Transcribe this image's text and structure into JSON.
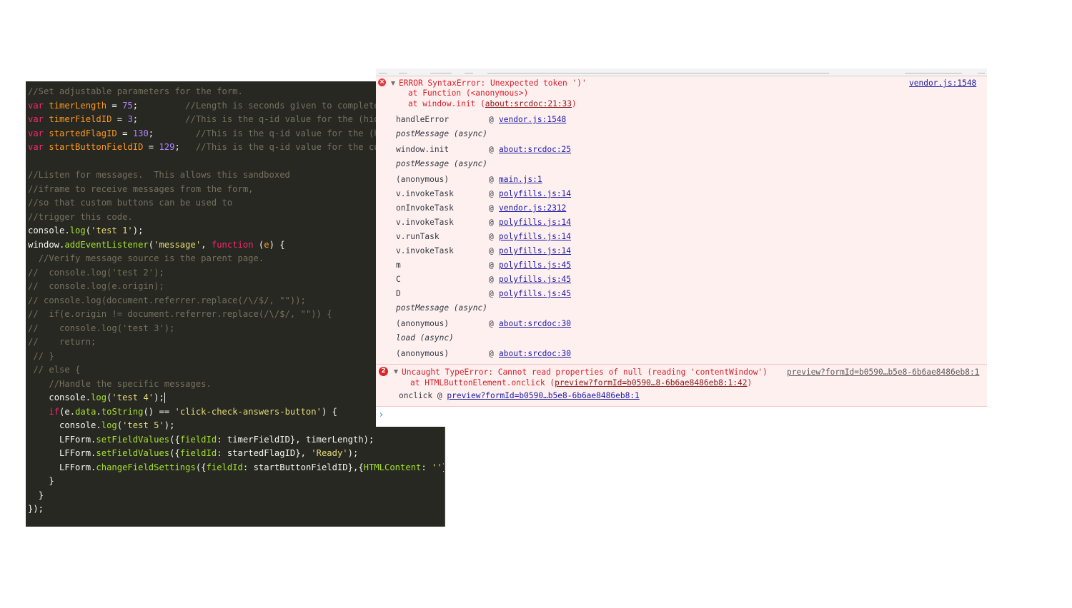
{
  "editor": {
    "lines": [
      {
        "indent": "",
        "tokens": [
          {
            "t": "//Set adjustable parameters for the form.",
            "c": "comment"
          }
        ]
      },
      {
        "indent": "",
        "tokens": [
          {
            "t": "var ",
            "c": "kw"
          },
          {
            "t": "timerLength",
            "c": "var"
          },
          {
            "t": " = ",
            "c": "plain"
          },
          {
            "t": "75",
            "c": "num"
          },
          {
            "t": ";         ",
            "c": "plain"
          },
          {
            "t": "//Length is seconds given to complete",
            "c": "comment"
          }
        ]
      },
      {
        "indent": "",
        "tokens": [
          {
            "t": "var ",
            "c": "kw"
          },
          {
            "t": "timerFieldID",
            "c": "var"
          },
          {
            "t": " = ",
            "c": "plain"
          },
          {
            "t": "3",
            "c": "num"
          },
          {
            "t": ";         ",
            "c": "plain"
          },
          {
            "t": "//This is the q-id value for the (hidd",
            "c": "comment"
          }
        ]
      },
      {
        "indent": "",
        "tokens": [
          {
            "t": "var ",
            "c": "kw"
          },
          {
            "t": "startedFlagID",
            "c": "var"
          },
          {
            "t": " = ",
            "c": "plain"
          },
          {
            "t": "130",
            "c": "num"
          },
          {
            "t": ";        ",
            "c": "plain"
          },
          {
            "t": "//This is the q-id value for the (hi",
            "c": "comment"
          }
        ]
      },
      {
        "indent": "",
        "tokens": [
          {
            "t": "var ",
            "c": "kw"
          },
          {
            "t": "startButtonFieldID",
            "c": "var"
          },
          {
            "t": " = ",
            "c": "plain"
          },
          {
            "t": "129",
            "c": "num"
          },
          {
            "t": ";   ",
            "c": "plain"
          },
          {
            "t": "//This is the q-id value for the cus",
            "c": "comment"
          }
        ]
      },
      {
        "indent": "",
        "tokens": []
      },
      {
        "indent": "",
        "tokens": [
          {
            "t": "//Listen for messages.  This allows this sandboxed",
            "c": "comment"
          }
        ]
      },
      {
        "indent": "",
        "tokens": [
          {
            "t": "//iframe to receive messages from the form,",
            "c": "comment"
          }
        ]
      },
      {
        "indent": "",
        "tokens": [
          {
            "t": "//so that custom buttons can be used to",
            "c": "comment"
          }
        ]
      },
      {
        "indent": "",
        "tokens": [
          {
            "t": "//trigger this code.",
            "c": "comment"
          }
        ]
      },
      {
        "indent": "",
        "tokens": [
          {
            "t": "console.",
            "c": "plain"
          },
          {
            "t": "log",
            "c": "fn"
          },
          {
            "t": "(",
            "c": "plain"
          },
          {
            "t": "'test 1'",
            "c": "str"
          },
          {
            "t": ");",
            "c": "plain"
          }
        ]
      },
      {
        "indent": "",
        "tokens": [
          {
            "t": "window.",
            "c": "plain"
          },
          {
            "t": "addEventListener",
            "c": "fn"
          },
          {
            "t": "(",
            "c": "plain"
          },
          {
            "t": "'message'",
            "c": "str"
          },
          {
            "t": ", ",
            "c": "plain"
          },
          {
            "t": "function",
            "c": "kw"
          },
          {
            "t": " (",
            "c": "plain"
          },
          {
            "t": "e",
            "c": "var"
          },
          {
            "t": ") {",
            "c": "plain"
          }
        ]
      },
      {
        "indent": "  ",
        "tokens": [
          {
            "t": "//Verify message source is the parent page.",
            "c": "comment"
          }
        ]
      },
      {
        "indent": "",
        "tokens": [
          {
            "t": "//  console.log('test 2');",
            "c": "comment"
          }
        ]
      },
      {
        "indent": "",
        "tokens": [
          {
            "t": "//  console.log(e.origin);",
            "c": "comment"
          }
        ]
      },
      {
        "indent": "",
        "tokens": [
          {
            "t": "// console.log(document.referrer.replace(/\\/$/, \"\"));",
            "c": "comment"
          }
        ]
      },
      {
        "indent": "",
        "tokens": [
          {
            "t": "//  if(e.origin != document.referrer.replace(/\\/$/, \"\")) {",
            "c": "comment"
          }
        ]
      },
      {
        "indent": "",
        "tokens": [
          {
            "t": "//    console.log('test 3');",
            "c": "comment"
          }
        ]
      },
      {
        "indent": "",
        "tokens": [
          {
            "t": "//    return;",
            "c": "comment"
          }
        ]
      },
      {
        "indent": " ",
        "tokens": [
          {
            "t": "// }",
            "c": "comment"
          }
        ]
      },
      {
        "indent": " ",
        "tokens": [
          {
            "t": "// else {",
            "c": "comment"
          }
        ]
      },
      {
        "indent": "    ",
        "tokens": [
          {
            "t": "//Handle the specific messages.",
            "c": "comment"
          }
        ]
      },
      {
        "indent": "    ",
        "tokens": [
          {
            "t": "console.",
            "c": "plain"
          },
          {
            "t": "log",
            "c": "fn"
          },
          {
            "t": "(",
            "c": "plain"
          },
          {
            "t": "'test 4'",
            "c": "str"
          },
          {
            "t": ");",
            "c": "plain"
          }
        ],
        "caret": true
      },
      {
        "indent": "    ",
        "tokens": [
          {
            "t": "if",
            "c": "kw"
          },
          {
            "t": "(e.",
            "c": "plain"
          },
          {
            "t": "data",
            "c": "fn"
          },
          {
            "t": ".",
            "c": "plain"
          },
          {
            "t": "toString",
            "c": "fn"
          },
          {
            "t": "() == ",
            "c": "plain"
          },
          {
            "t": "'click-check-answers-button'",
            "c": "str"
          },
          {
            "t": ") {",
            "c": "plain"
          }
        ]
      },
      {
        "indent": "      ",
        "tokens": [
          {
            "t": "console.",
            "c": "plain"
          },
          {
            "t": "log",
            "c": "fn"
          },
          {
            "t": "(",
            "c": "plain"
          },
          {
            "t": "'test 5'",
            "c": "str"
          },
          {
            "t": ");",
            "c": "plain"
          }
        ]
      },
      {
        "indent": "      ",
        "tokens": [
          {
            "t": "LFForm.",
            "c": "plain"
          },
          {
            "t": "setFieldValues",
            "c": "fn"
          },
          {
            "t": "({",
            "c": "plain"
          },
          {
            "t": "fieldId",
            "c": "fn"
          },
          {
            "t": ": timerFieldID}, timerLength);",
            "c": "plain"
          }
        ]
      },
      {
        "indent": "      ",
        "tokens": [
          {
            "t": "LFForm.",
            "c": "plain"
          },
          {
            "t": "setFieldValues",
            "c": "fn"
          },
          {
            "t": "({",
            "c": "plain"
          },
          {
            "t": "fieldId",
            "c": "fn"
          },
          {
            "t": ": startedFlagID}, ",
            "c": "plain"
          },
          {
            "t": "'Ready'",
            "c": "str"
          },
          {
            "t": ");",
            "c": "plain"
          }
        ]
      },
      {
        "indent": "      ",
        "tokens": [
          {
            "t": "LFForm.",
            "c": "plain"
          },
          {
            "t": "changeFieldSettings",
            "c": "fn"
          },
          {
            "t": "({",
            "c": "plain"
          },
          {
            "t": "fieldId",
            "c": "fn"
          },
          {
            "t": ": startButtonFieldID},{",
            "c": "plain"
          },
          {
            "t": "HTMLContent",
            "c": "fn"
          },
          {
            "t": ": ",
            "c": "plain"
          },
          {
            "t": "''",
            "c": "str"
          },
          {
            "t": "});",
            "c": "plain"
          }
        ]
      },
      {
        "indent": "    ",
        "tokens": [
          {
            "t": "}",
            "c": "plain"
          }
        ]
      },
      {
        "indent": "  ",
        "tokens": [
          {
            "t": "}",
            "c": "plain"
          }
        ]
      },
      {
        "indent": "",
        "tokens": [
          {
            "t": "});",
            "c": "plain"
          }
        ]
      }
    ]
  },
  "console": {
    "error1": {
      "icon": "error-circle-icon",
      "message": "ERROR SyntaxError: Unexpected token ')'",
      "source_link": "vendor.js:1548",
      "at1_prefix": "at Function (<anonymous>)",
      "at2_prefix": "at window.init (",
      "at2_link": "about:srcdoc:21:33",
      "at2_suffix": ")",
      "stack": [
        {
          "fn": "handleError",
          "link": "vendor.js:1548"
        },
        {
          "fn": "postMessage (async)",
          "async": true
        },
        {
          "fn": "window.init",
          "link": "about:srcdoc:25"
        },
        {
          "fn": "postMessage (async)",
          "async": true
        },
        {
          "fn": "(anonymous)",
          "link": "main.js:1"
        },
        {
          "fn": "v.invokeTask",
          "link": "polyfills.js:14"
        },
        {
          "fn": "onInvokeTask",
          "link": "vendor.js:2312"
        },
        {
          "fn": "v.invokeTask",
          "link": "polyfills.js:14"
        },
        {
          "fn": "v.runTask",
          "link": "polyfills.js:14"
        },
        {
          "fn": "v.invokeTask",
          "link": "polyfills.js:14"
        },
        {
          "fn": "m",
          "link": "polyfills.js:45"
        },
        {
          "fn": "C",
          "link": "polyfills.js:45"
        },
        {
          "fn": "D",
          "link": "polyfills.js:45"
        },
        {
          "fn": "postMessage (async)",
          "async": true
        },
        {
          "fn": "(anonymous)",
          "link": "about:srcdoc:30"
        },
        {
          "fn": "load (async)",
          "async": true
        },
        {
          "fn": "(anonymous)",
          "link": "about:srcdoc:30"
        }
      ],
      "at_symbol": "@"
    },
    "error2": {
      "count": "2",
      "message": "Uncaught TypeError: Cannot read properties of null (reading 'contentWindow')",
      "source_link": "preview?formId=b0590…b5e8-6b6ae8486eb8:1",
      "at_prefix": "at HTMLButtonElement.onclick (",
      "at_link": "preview?formId=b0590…8-6b6ae8486eb8:1:42",
      "at_suffix": ")",
      "onclick_prefix": "onclick @ ",
      "onclick_link": "preview?formId=b0590…b5e8-6b6ae8486eb8:1"
    },
    "prompt_icon": "chevron-right-icon"
  }
}
